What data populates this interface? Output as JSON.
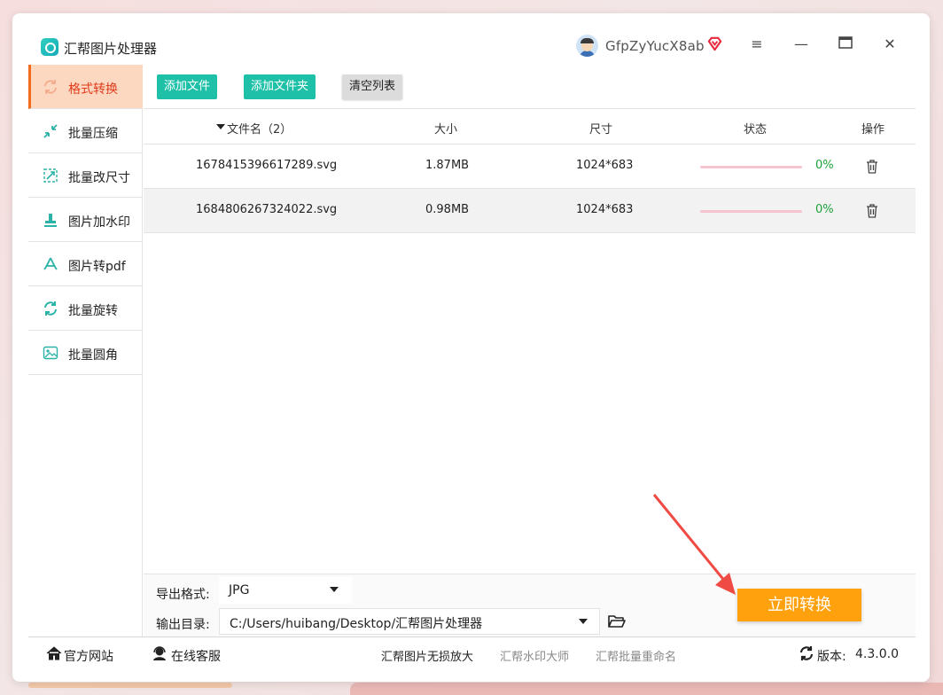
{
  "app": {
    "title": "汇帮图片处理器",
    "username": "GfpZyYucX8ab",
    "accent_color": "#f26a1b",
    "primary_button_color": "#1ec1a8",
    "convert_button_color": "#ffa10d"
  },
  "window_controls": {
    "menu": "≡",
    "minimize": "—",
    "maximize": "□",
    "close": "✕"
  },
  "sidebar": {
    "items": [
      {
        "label": "格式转换",
        "icon": "format-convert-icon",
        "active": true
      },
      {
        "label": "批量压缩",
        "icon": "compress-icon"
      },
      {
        "label": "批量改尺寸",
        "icon": "resize-icon"
      },
      {
        "label": "图片加水印",
        "icon": "watermark-icon"
      },
      {
        "label": "图片转pdf",
        "icon": "pdf-icon"
      },
      {
        "label": "批量旋转",
        "icon": "rotate-icon"
      },
      {
        "label": "批量圆角",
        "icon": "rounded-corner-icon"
      }
    ]
  },
  "toolbar": {
    "add_file": "添加文件",
    "add_folder": "添加文件夹",
    "clear_list": "清空列表"
  },
  "table": {
    "headers": {
      "filename": "文件名（2）",
      "size": "大小",
      "dimensions": "尺寸",
      "status": "状态",
      "actions": "操作"
    },
    "rows": [
      {
        "filename": "1678415396617289.svg",
        "size": "1.87MB",
        "dimensions": "1024*683",
        "progress": 0,
        "progress_text": "0%"
      },
      {
        "filename": "1684806267324022.svg",
        "size": "0.98MB",
        "dimensions": "1024*683",
        "progress": 0,
        "progress_text": "0%"
      }
    ]
  },
  "settings": {
    "format_label": "导出格式:",
    "format_value": "JPG",
    "output_label": "输出目录:",
    "output_value": "C:/Users/huibang/Desktop/汇帮图片处理器"
  },
  "convert_button": "立即转换",
  "footer": {
    "website": "官方网站",
    "support": "在线客服",
    "links": [
      "汇帮图片无损放大",
      "汇帮水印大师",
      "汇帮批量重命名"
    ],
    "version_label": "版本:",
    "version": "4.3.0.0"
  }
}
